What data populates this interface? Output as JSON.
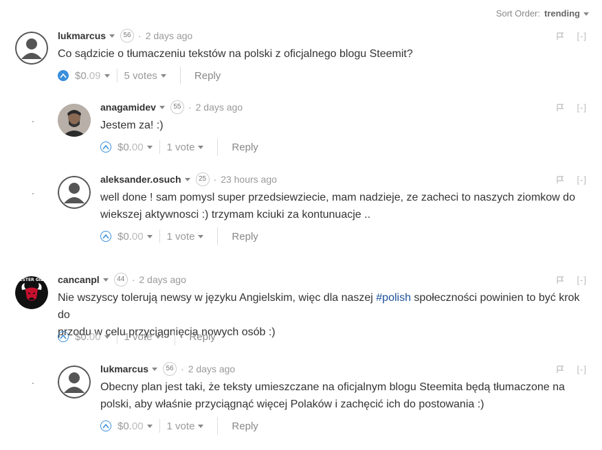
{
  "sort": {
    "label": "Sort Order:",
    "value": "trending"
  },
  "comments": [
    {
      "author": "lukmarcus",
      "rep": "56",
      "time": "2 days ago",
      "body": "Co sądzicie o tłumaczeniu tekstów na polski z oficjalnego blogu Steemit?",
      "payout_main": "$0.",
      "payout_dec": "09",
      "votes": "5 votes",
      "reply": "Reply",
      "flag": "flag-icon",
      "collapse": "[-]",
      "avatar": "default-avatar",
      "voted": true
    },
    {
      "author": "anagamidev",
      "rep": "55",
      "time": "2 days ago",
      "body": "Jestem za! :)",
      "payout_main": "$0.",
      "payout_dec": "00",
      "votes": "1 vote",
      "reply": "Reply",
      "collapse": "[-]",
      "avatar": "photo-avatar",
      "voted": false
    },
    {
      "author": "aleksander.osuch",
      "rep": "25",
      "time": "23 hours ago",
      "body_line1": "well done ! sam pomysl super przedsiewziecie, mam nadzieje, ze zacheci to naszych ziomkow do",
      "body_line2": "wiekszej aktywnosci :) trzymam kciuki za kontunuacje ..",
      "payout_main": "$0.",
      "payout_dec": "00",
      "votes": "1 vote",
      "reply": "Reply",
      "collapse": "[-]",
      "avatar": "default-avatar",
      "voted": false
    },
    {
      "author": "cancanpl",
      "rep": "44",
      "time": "2 days ago",
      "body_pre": "Nie wszyscy tolerują newsy w języku Angielskim, więc dla naszej ",
      "body_tag": "#polish",
      "body_post": " społeczności powinien to być krok do",
      "body_line2": "przodu w celu przyciągnięcia nowych osób :)",
      "payout_main": "$0.",
      "payout_dec": "00",
      "votes": "1 vote",
      "reply": "Reply",
      "collapse": "[-]",
      "avatar": "bulls-logo-avatar",
      "avatar_text": "TESTER GIER",
      "voted": false
    },
    {
      "author": "lukmarcus",
      "rep": "56",
      "time": "2 days ago",
      "body_line1": "Obecny plan jest taki, że teksty umieszczane na oficjalnym blogu Steemita będą tłumaczone na",
      "body_line2": "polski, aby właśnie przyciągnąć więcej Polaków i zachęcić ich do postowania :)",
      "payout_main": "$0.",
      "payout_dec": "00",
      "votes": "1 vote",
      "reply": "Reply",
      "collapse": "[-]",
      "avatar": "default-avatar",
      "voted": false
    }
  ],
  "colors": {
    "accent": "#3a8edb",
    "tag": "#1a5099",
    "text": "#333333",
    "muted": "#999999"
  }
}
